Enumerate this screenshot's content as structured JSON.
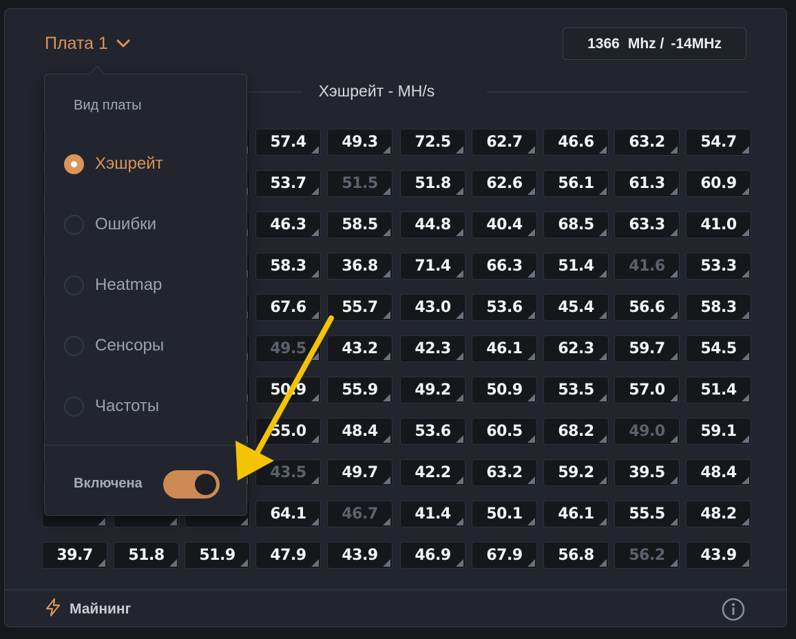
{
  "board": {
    "label": "Плата 1"
  },
  "freq": {
    "value": "1366",
    "unit": "Mhz /",
    "delta": "-14MHz"
  },
  "hashrate_title": "Хэшрейт - MH/s",
  "grid": {
    "rows": [
      [
        {
          "v": "",
          "d": false
        },
        {
          "v": "",
          "d": false
        },
        {
          "v": "",
          "d": false
        },
        {
          "v": "57.4",
          "d": false
        },
        {
          "v": "49.3",
          "d": false
        },
        {
          "v": "72.5",
          "d": false
        },
        {
          "v": "62.7",
          "d": false
        },
        {
          "v": "46.6",
          "d": false
        },
        {
          "v": "63.2",
          "d": false
        },
        {
          "v": "54.7",
          "d": false
        }
      ],
      [
        {
          "v": "",
          "d": false
        },
        {
          "v": "",
          "d": false
        },
        {
          "v": "",
          "d": false
        },
        {
          "v": "53.7",
          "d": false
        },
        {
          "v": "51.5",
          "d": true
        },
        {
          "v": "51.8",
          "d": false
        },
        {
          "v": "62.6",
          "d": false
        },
        {
          "v": "56.1",
          "d": false
        },
        {
          "v": "61.3",
          "d": false
        },
        {
          "v": "60.9",
          "d": false
        }
      ],
      [
        {
          "v": "",
          "d": false
        },
        {
          "v": "",
          "d": false
        },
        {
          "v": "",
          "d": false
        },
        {
          "v": "46.3",
          "d": false
        },
        {
          "v": "58.5",
          "d": false
        },
        {
          "v": "44.8",
          "d": false
        },
        {
          "v": "40.4",
          "d": false
        },
        {
          "v": "68.5",
          "d": false
        },
        {
          "v": "63.3",
          "d": false
        },
        {
          "v": "41.0",
          "d": false
        }
      ],
      [
        {
          "v": "",
          "d": false
        },
        {
          "v": "",
          "d": false
        },
        {
          "v": "",
          "d": false
        },
        {
          "v": "58.3",
          "d": false
        },
        {
          "v": "36.8",
          "d": false
        },
        {
          "v": "71.4",
          "d": false
        },
        {
          "v": "66.3",
          "d": false
        },
        {
          "v": "51.4",
          "d": false
        },
        {
          "v": "41.6",
          "d": true
        },
        {
          "v": "53.3",
          "d": false
        }
      ],
      [
        {
          "v": "",
          "d": false
        },
        {
          "v": "",
          "d": false
        },
        {
          "v": "",
          "d": false
        },
        {
          "v": "67.6",
          "d": false
        },
        {
          "v": "55.7",
          "d": false
        },
        {
          "v": "43.0",
          "d": false
        },
        {
          "v": "53.6",
          "d": false
        },
        {
          "v": "45.4",
          "d": false
        },
        {
          "v": "56.6",
          "d": false
        },
        {
          "v": "58.3",
          "d": false
        }
      ],
      [
        {
          "v": "",
          "d": false
        },
        {
          "v": "",
          "d": false
        },
        {
          "v": "",
          "d": false
        },
        {
          "v": "49.5",
          "d": true
        },
        {
          "v": "43.2",
          "d": false
        },
        {
          "v": "42.3",
          "d": false
        },
        {
          "v": "46.1",
          "d": false
        },
        {
          "v": "62.3",
          "d": false
        },
        {
          "v": "59.7",
          "d": false
        },
        {
          "v": "54.5",
          "d": false
        }
      ],
      [
        {
          "v": "",
          "d": false
        },
        {
          "v": "",
          "d": false
        },
        {
          "v": "",
          "d": false
        },
        {
          "v": "50.9",
          "d": false
        },
        {
          "v": "55.9",
          "d": false
        },
        {
          "v": "49.2",
          "d": false
        },
        {
          "v": "50.9",
          "d": false
        },
        {
          "v": "53.5",
          "d": false
        },
        {
          "v": "57.0",
          "d": false
        },
        {
          "v": "51.4",
          "d": false
        }
      ],
      [
        {
          "v": "",
          "d": false
        },
        {
          "v": "",
          "d": false
        },
        {
          "v": "",
          "d": false
        },
        {
          "v": "55.0",
          "d": false
        },
        {
          "v": "48.4",
          "d": false
        },
        {
          "v": "53.6",
          "d": false
        },
        {
          "v": "60.5",
          "d": false
        },
        {
          "v": "68.2",
          "d": false
        },
        {
          "v": "49.0",
          "d": true
        },
        {
          "v": "59.1",
          "d": false
        }
      ],
      [
        {
          "v": "",
          "d": false
        },
        {
          "v": "",
          "d": false
        },
        {
          "v": "",
          "d": false
        },
        {
          "v": "43.5",
          "d": true
        },
        {
          "v": "49.7",
          "d": false
        },
        {
          "v": "42.2",
          "d": false
        },
        {
          "v": "63.2",
          "d": false
        },
        {
          "v": "59.2",
          "d": false
        },
        {
          "v": "39.5",
          "d": false
        },
        {
          "v": "48.4",
          "d": false
        }
      ],
      [
        {
          "v": "",
          "d": false
        },
        {
          "v": "",
          "d": false
        },
        {
          "v": "",
          "d": false
        },
        {
          "v": "64.1",
          "d": false
        },
        {
          "v": "46.7",
          "d": true
        },
        {
          "v": "41.4",
          "d": false
        },
        {
          "v": "50.1",
          "d": false
        },
        {
          "v": "46.1",
          "d": false
        },
        {
          "v": "55.5",
          "d": false
        },
        {
          "v": "48.2",
          "d": false
        }
      ],
      [
        {
          "v": "39.7",
          "d": false
        },
        {
          "v": "51.8",
          "d": false
        },
        {
          "v": "51.9",
          "d": false
        },
        {
          "v": "47.9",
          "d": false
        },
        {
          "v": "43.9",
          "d": false
        },
        {
          "v": "46.9",
          "d": false
        },
        {
          "v": "67.9",
          "d": false
        },
        {
          "v": "56.8",
          "d": false
        },
        {
          "v": "56.2",
          "d": true
        },
        {
          "v": "43.9",
          "d": false
        }
      ]
    ]
  },
  "dropdown": {
    "title": "Вид платы",
    "options": [
      {
        "label": "Хэшрейт",
        "selected": true
      },
      {
        "label": "Ошибки",
        "selected": false
      },
      {
        "label": "Heatmap",
        "selected": false
      },
      {
        "label": "Сенсоры",
        "selected": false
      },
      {
        "label": "Частоты",
        "selected": false
      }
    ],
    "toggle_label": "Включена",
    "toggle_on": true
  },
  "footer": {
    "label": "Майнинг"
  },
  "colors": {
    "accent": "#d9955a",
    "annotation_arrow": "#f5c400",
    "dim_text": "#5c626d"
  }
}
